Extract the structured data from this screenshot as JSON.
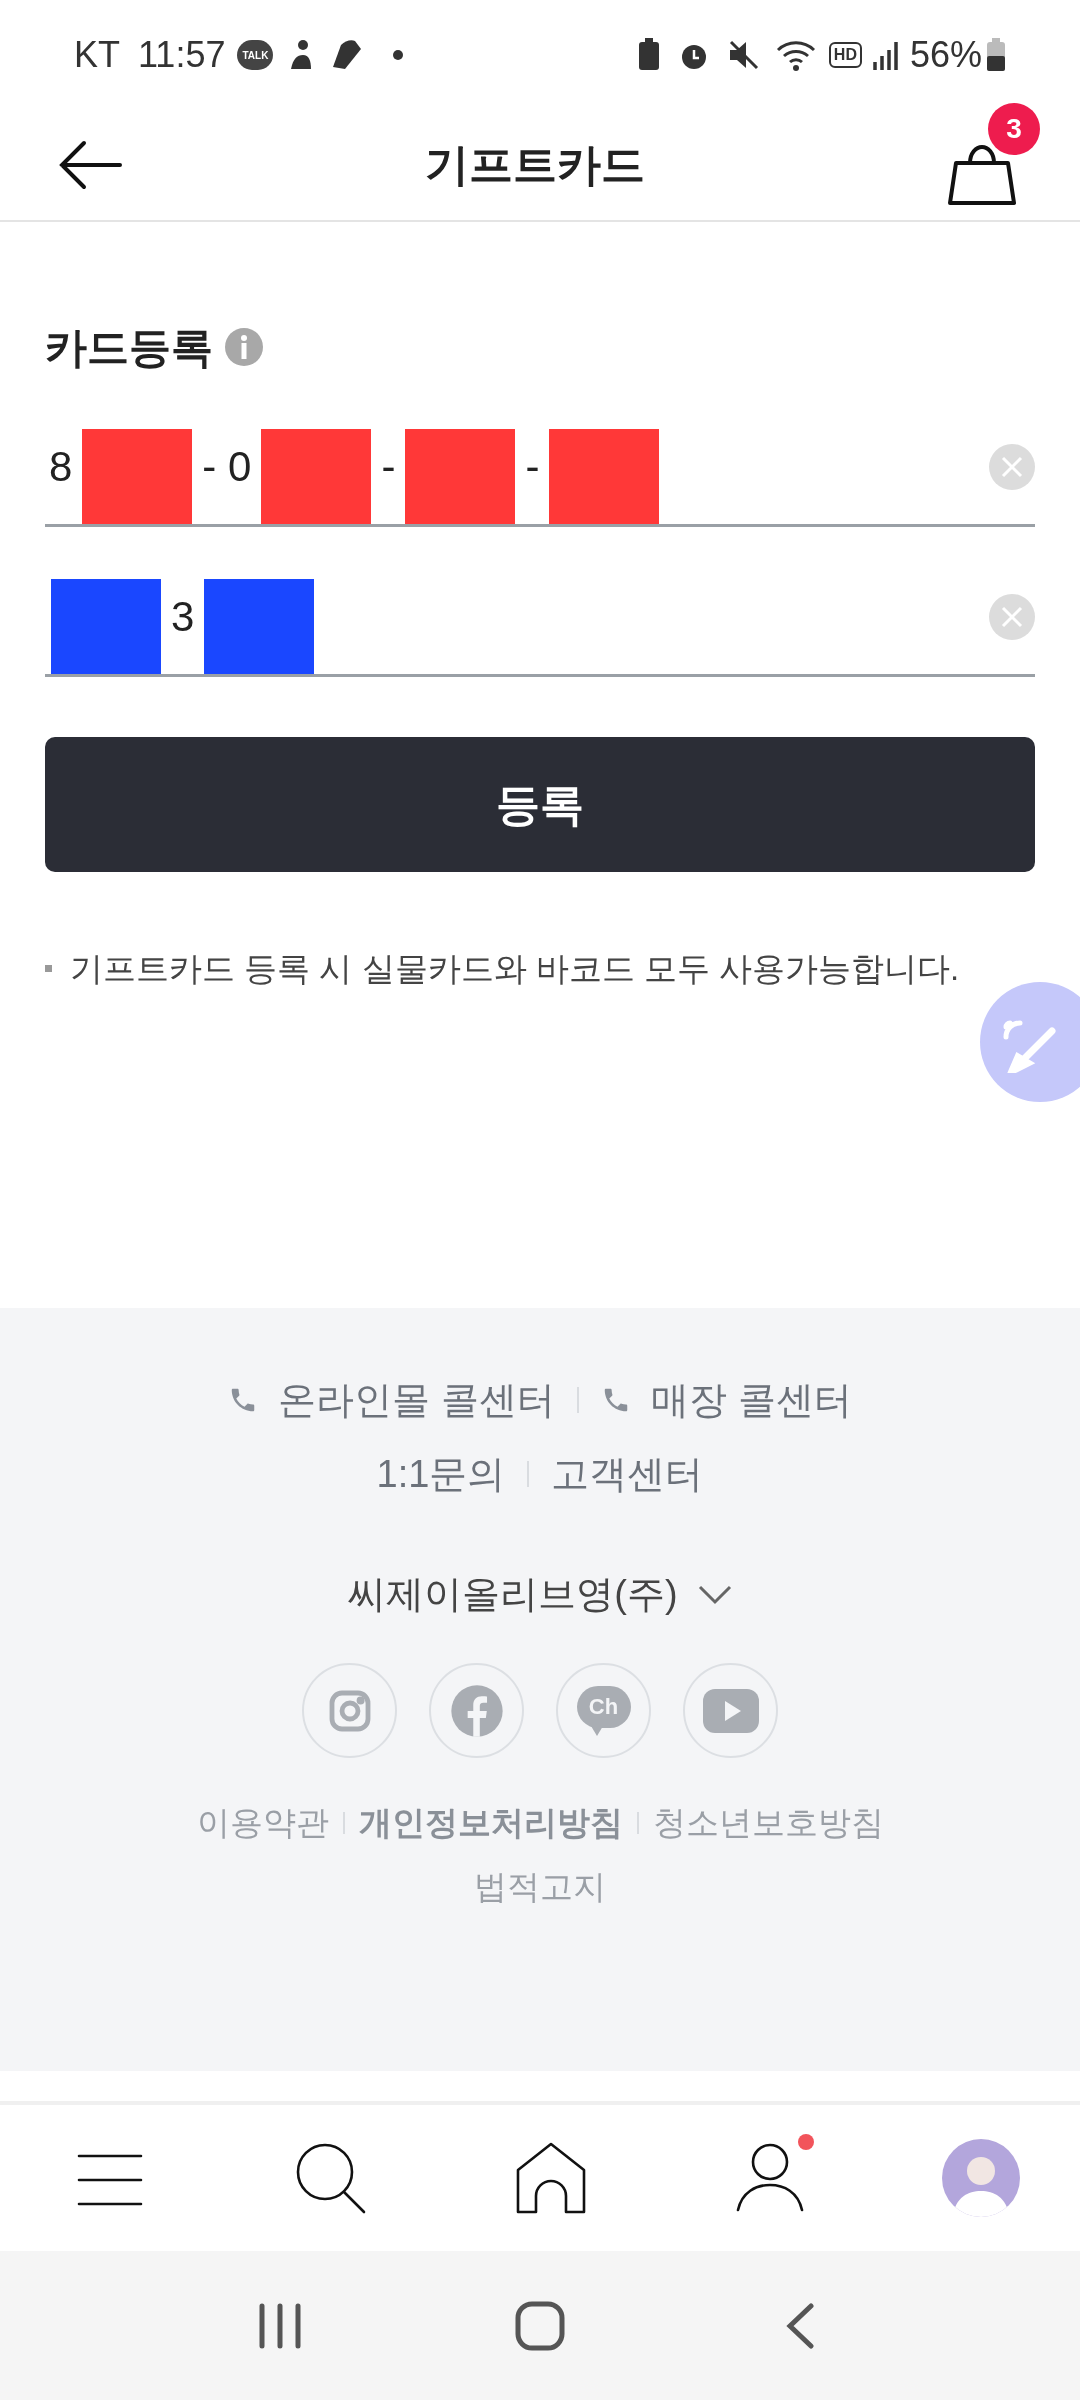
{
  "status_bar": {
    "carrier": "KT",
    "time": "11:57",
    "talk_label": "TALK",
    "hd_label": "HD",
    "battery": "56%"
  },
  "header": {
    "title": "기프트카드",
    "cart_count": "3"
  },
  "section": {
    "title": "카드등록"
  },
  "fields": [
    {
      "parts": [
        {
          "kind": "text",
          "text": "8"
        },
        {
          "kind": "redaction",
          "color": "#ff3838"
        },
        {
          "kind": "text",
          "text": "- 0"
        },
        {
          "kind": "redaction",
          "color": "#ff3838"
        },
        {
          "kind": "text",
          "text": "-"
        },
        {
          "kind": "redaction",
          "color": "#ff3838"
        },
        {
          "kind": "text",
          "text": "-"
        },
        {
          "kind": "redaction",
          "color": "#ff3838"
        }
      ]
    },
    {
      "parts": [
        {
          "kind": "redaction",
          "color": "#1a47ff"
        },
        {
          "kind": "text",
          "text": "3"
        },
        {
          "kind": "redaction",
          "color": "#1a47ff"
        }
      ]
    }
  ],
  "register_button": "등록",
  "notice": "기프트카드 등록 시 실물카드와 바코드 모두 사용가능합니다.",
  "footer": {
    "call_links": [
      "온라인몰 콜센터",
      "매장 콜센터"
    ],
    "help_links": [
      "1:1문의",
      "고객센터"
    ],
    "company": "씨제이올리브영(주)",
    "social": [
      {
        "kind": "instagram"
      },
      {
        "kind": "facebook"
      },
      {
        "kind": "channel",
        "label": "Ch"
      },
      {
        "kind": "youtube"
      }
    ],
    "policy_links": [
      {
        "label": "이용약관",
        "bold": false
      },
      {
        "label": "개인정보처리방침",
        "bold": true
      },
      {
        "label": "청소년보호방침",
        "bold": false
      }
    ],
    "legal": "법적고지"
  },
  "bottom_nav": [
    {
      "kind": "menu",
      "dot": false
    },
    {
      "kind": "search",
      "dot": false
    },
    {
      "kind": "home",
      "dot": false
    },
    {
      "kind": "account",
      "dot": true
    },
    {
      "kind": "avatar",
      "dot": false
    }
  ]
}
